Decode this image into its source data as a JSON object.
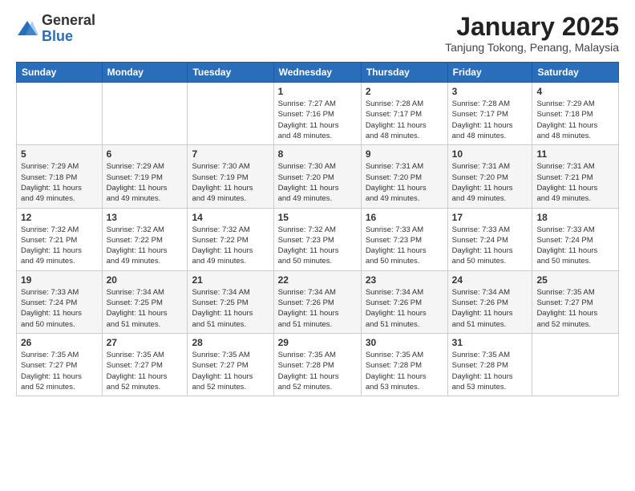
{
  "logo": {
    "general": "General",
    "blue": "Blue"
  },
  "title": "January 2025",
  "subtitle": "Tanjung Tokong, Penang, Malaysia",
  "days_header": [
    "Sunday",
    "Monday",
    "Tuesday",
    "Wednesday",
    "Thursday",
    "Friday",
    "Saturday"
  ],
  "weeks": [
    [
      {
        "day": "",
        "info": ""
      },
      {
        "day": "",
        "info": ""
      },
      {
        "day": "",
        "info": ""
      },
      {
        "day": "1",
        "info": "Sunrise: 7:27 AM\nSunset: 7:16 PM\nDaylight: 11 hours\nand 48 minutes."
      },
      {
        "day": "2",
        "info": "Sunrise: 7:28 AM\nSunset: 7:17 PM\nDaylight: 11 hours\nand 48 minutes."
      },
      {
        "day": "3",
        "info": "Sunrise: 7:28 AM\nSunset: 7:17 PM\nDaylight: 11 hours\nand 48 minutes."
      },
      {
        "day": "4",
        "info": "Sunrise: 7:29 AM\nSunset: 7:18 PM\nDaylight: 11 hours\nand 48 minutes."
      }
    ],
    [
      {
        "day": "5",
        "info": "Sunrise: 7:29 AM\nSunset: 7:18 PM\nDaylight: 11 hours\nand 49 minutes."
      },
      {
        "day": "6",
        "info": "Sunrise: 7:29 AM\nSunset: 7:19 PM\nDaylight: 11 hours\nand 49 minutes."
      },
      {
        "day": "7",
        "info": "Sunrise: 7:30 AM\nSunset: 7:19 PM\nDaylight: 11 hours\nand 49 minutes."
      },
      {
        "day": "8",
        "info": "Sunrise: 7:30 AM\nSunset: 7:20 PM\nDaylight: 11 hours\nand 49 minutes."
      },
      {
        "day": "9",
        "info": "Sunrise: 7:31 AM\nSunset: 7:20 PM\nDaylight: 11 hours\nand 49 minutes."
      },
      {
        "day": "10",
        "info": "Sunrise: 7:31 AM\nSunset: 7:20 PM\nDaylight: 11 hours\nand 49 minutes."
      },
      {
        "day": "11",
        "info": "Sunrise: 7:31 AM\nSunset: 7:21 PM\nDaylight: 11 hours\nand 49 minutes."
      }
    ],
    [
      {
        "day": "12",
        "info": "Sunrise: 7:32 AM\nSunset: 7:21 PM\nDaylight: 11 hours\nand 49 minutes."
      },
      {
        "day": "13",
        "info": "Sunrise: 7:32 AM\nSunset: 7:22 PM\nDaylight: 11 hours\nand 49 minutes."
      },
      {
        "day": "14",
        "info": "Sunrise: 7:32 AM\nSunset: 7:22 PM\nDaylight: 11 hours\nand 49 minutes."
      },
      {
        "day": "15",
        "info": "Sunrise: 7:32 AM\nSunset: 7:23 PM\nDaylight: 11 hours\nand 50 minutes."
      },
      {
        "day": "16",
        "info": "Sunrise: 7:33 AM\nSunset: 7:23 PM\nDaylight: 11 hours\nand 50 minutes."
      },
      {
        "day": "17",
        "info": "Sunrise: 7:33 AM\nSunset: 7:24 PM\nDaylight: 11 hours\nand 50 minutes."
      },
      {
        "day": "18",
        "info": "Sunrise: 7:33 AM\nSunset: 7:24 PM\nDaylight: 11 hours\nand 50 minutes."
      }
    ],
    [
      {
        "day": "19",
        "info": "Sunrise: 7:33 AM\nSunset: 7:24 PM\nDaylight: 11 hours\nand 50 minutes."
      },
      {
        "day": "20",
        "info": "Sunrise: 7:34 AM\nSunset: 7:25 PM\nDaylight: 11 hours\nand 51 minutes."
      },
      {
        "day": "21",
        "info": "Sunrise: 7:34 AM\nSunset: 7:25 PM\nDaylight: 11 hours\nand 51 minutes."
      },
      {
        "day": "22",
        "info": "Sunrise: 7:34 AM\nSunset: 7:26 PM\nDaylight: 11 hours\nand 51 minutes."
      },
      {
        "day": "23",
        "info": "Sunrise: 7:34 AM\nSunset: 7:26 PM\nDaylight: 11 hours\nand 51 minutes."
      },
      {
        "day": "24",
        "info": "Sunrise: 7:34 AM\nSunset: 7:26 PM\nDaylight: 11 hours\nand 51 minutes."
      },
      {
        "day": "25",
        "info": "Sunrise: 7:35 AM\nSunset: 7:27 PM\nDaylight: 11 hours\nand 52 minutes."
      }
    ],
    [
      {
        "day": "26",
        "info": "Sunrise: 7:35 AM\nSunset: 7:27 PM\nDaylight: 11 hours\nand 52 minutes."
      },
      {
        "day": "27",
        "info": "Sunrise: 7:35 AM\nSunset: 7:27 PM\nDaylight: 11 hours\nand 52 minutes."
      },
      {
        "day": "28",
        "info": "Sunrise: 7:35 AM\nSunset: 7:27 PM\nDaylight: 11 hours\nand 52 minutes."
      },
      {
        "day": "29",
        "info": "Sunrise: 7:35 AM\nSunset: 7:28 PM\nDaylight: 11 hours\nand 52 minutes."
      },
      {
        "day": "30",
        "info": "Sunrise: 7:35 AM\nSunset: 7:28 PM\nDaylight: 11 hours\nand 53 minutes."
      },
      {
        "day": "31",
        "info": "Sunrise: 7:35 AM\nSunset: 7:28 PM\nDaylight: 11 hours\nand 53 minutes."
      },
      {
        "day": "",
        "info": ""
      }
    ]
  ]
}
